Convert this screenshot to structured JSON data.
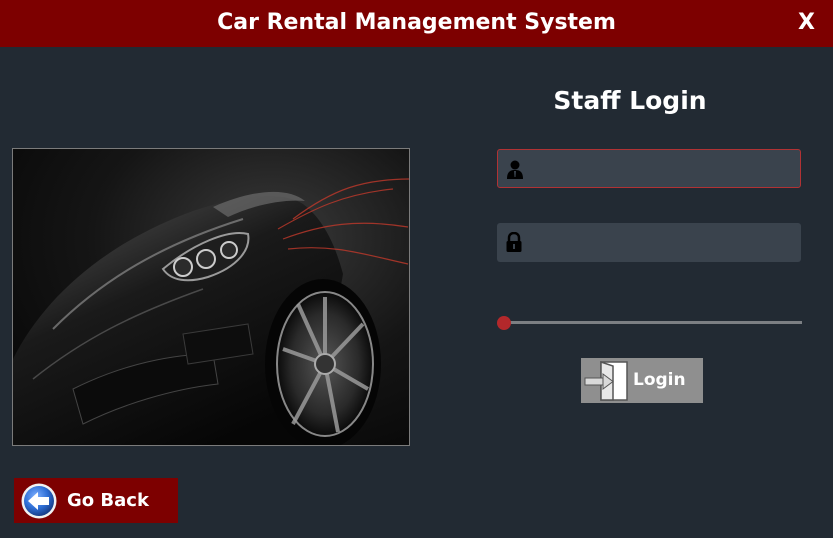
{
  "window": {
    "title": "Car Rental Management System",
    "close_label": "X"
  },
  "login": {
    "heading": "Staff Login",
    "username": {
      "value": "",
      "placeholder": "",
      "icon": "user-icon"
    },
    "password": {
      "value": "",
      "placeholder": "",
      "icon": "lock-icon"
    },
    "slider_value": 0,
    "button_label": "Login",
    "button_icon": "door-enter-icon"
  },
  "footer": {
    "back_label": "Go Back",
    "back_icon": "back-arrow-icon"
  },
  "colors": {
    "titlebar": "#7d0000",
    "background": "#222a33",
    "field": "#3a434d",
    "accent": "#b3282b",
    "login_button": "#8f8f8f"
  }
}
